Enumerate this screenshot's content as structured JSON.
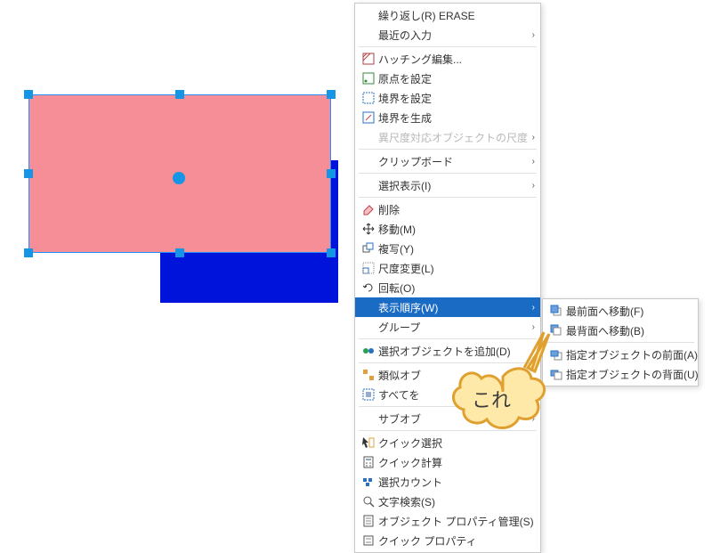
{
  "canvas": {
    "blue_rect": "selected-rect-blue",
    "pink_rect": "selected-rect-pink"
  },
  "menu": {
    "repeat": "繰り返し(R) ERASE",
    "recent_input": "最近の入力",
    "hatch_edit": "ハッチング編集...",
    "set_origin": "原点を設定",
    "set_boundary": "境界を設定",
    "gen_boundary": "境界を生成",
    "ann_scale": "異尺度対応オブジェクトの尺度",
    "clipboard": "クリップボード",
    "display_select": "選択表示(I)",
    "erase": "削除",
    "move": "移動(M)",
    "copy": "複写(Y)",
    "scale": "尺度変更(L)",
    "rotate": "回転(O)",
    "draw_order": "表示順序(W)",
    "group": "グループ",
    "add_selection": "選択オブジェクトを追加(D)",
    "similar": "類似オブ",
    "select_all": "すべてを",
    "subobj": "サブオブ",
    "quick_select": "クイック選択",
    "quick_calc": "クイック計算",
    "sel_count": "選択カウント",
    "find": "文字検索(S)",
    "prop_mgr": "オブジェクト プロパティ管理(S)",
    "quick_prop": "クイック プロパティ"
  },
  "submenu": {
    "front": "最前面へ移動(F)",
    "back": "最背面へ移動(B)",
    "above": "指定オブジェクトの前面(A)",
    "below": "指定オブジェクトの背面(U)"
  },
  "callout": "これ"
}
